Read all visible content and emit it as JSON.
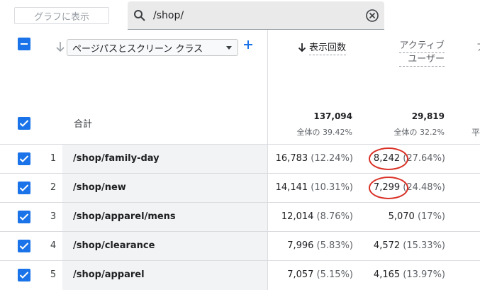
{
  "toolbar": {
    "chart_button": "グラフに表示",
    "search_query": "/shop/"
  },
  "header": {
    "dimension_select": "ページパスとスクリーン クラス",
    "metric1": "表示回数",
    "metric2_line1": "アクティブ",
    "metric2_line2": "ユーザー"
  },
  "totals": {
    "label": "合計",
    "views": "137,094",
    "views_share": "全体の 39.42%",
    "users": "29,819",
    "users_share": "全体の 32.2%",
    "cut_label": "平"
  },
  "rows": [
    {
      "idx": "1",
      "path": "/shop/family-day",
      "views": "16,783",
      "views_pct": "(12.24%)",
      "users": "8,242",
      "users_pct": "(27.64%)"
    },
    {
      "idx": "2",
      "path": "/shop/new",
      "views": "14,141",
      "views_pct": "(10.31%)",
      "users": "7,299",
      "users_pct": "(24.48%)"
    },
    {
      "idx": "3",
      "path": "/shop/apparel/mens",
      "views": "12,014",
      "views_pct": "(8.76%)",
      "users": "5,070",
      "users_pct": "(17%)"
    },
    {
      "idx": "4",
      "path": "/shop/clearance",
      "views": "7,996",
      "views_pct": "(5.83%)",
      "users": "4,572",
      "users_pct": "(15.33%)"
    },
    {
      "idx": "5",
      "path": "/shop/apparel",
      "views": "7,057",
      "views_pct": "(5.15%)",
      "users": "4,165",
      "users_pct": "(13.97%)"
    }
  ],
  "colors": {
    "accent": "#1a73e8",
    "highlight": "#d93025"
  }
}
